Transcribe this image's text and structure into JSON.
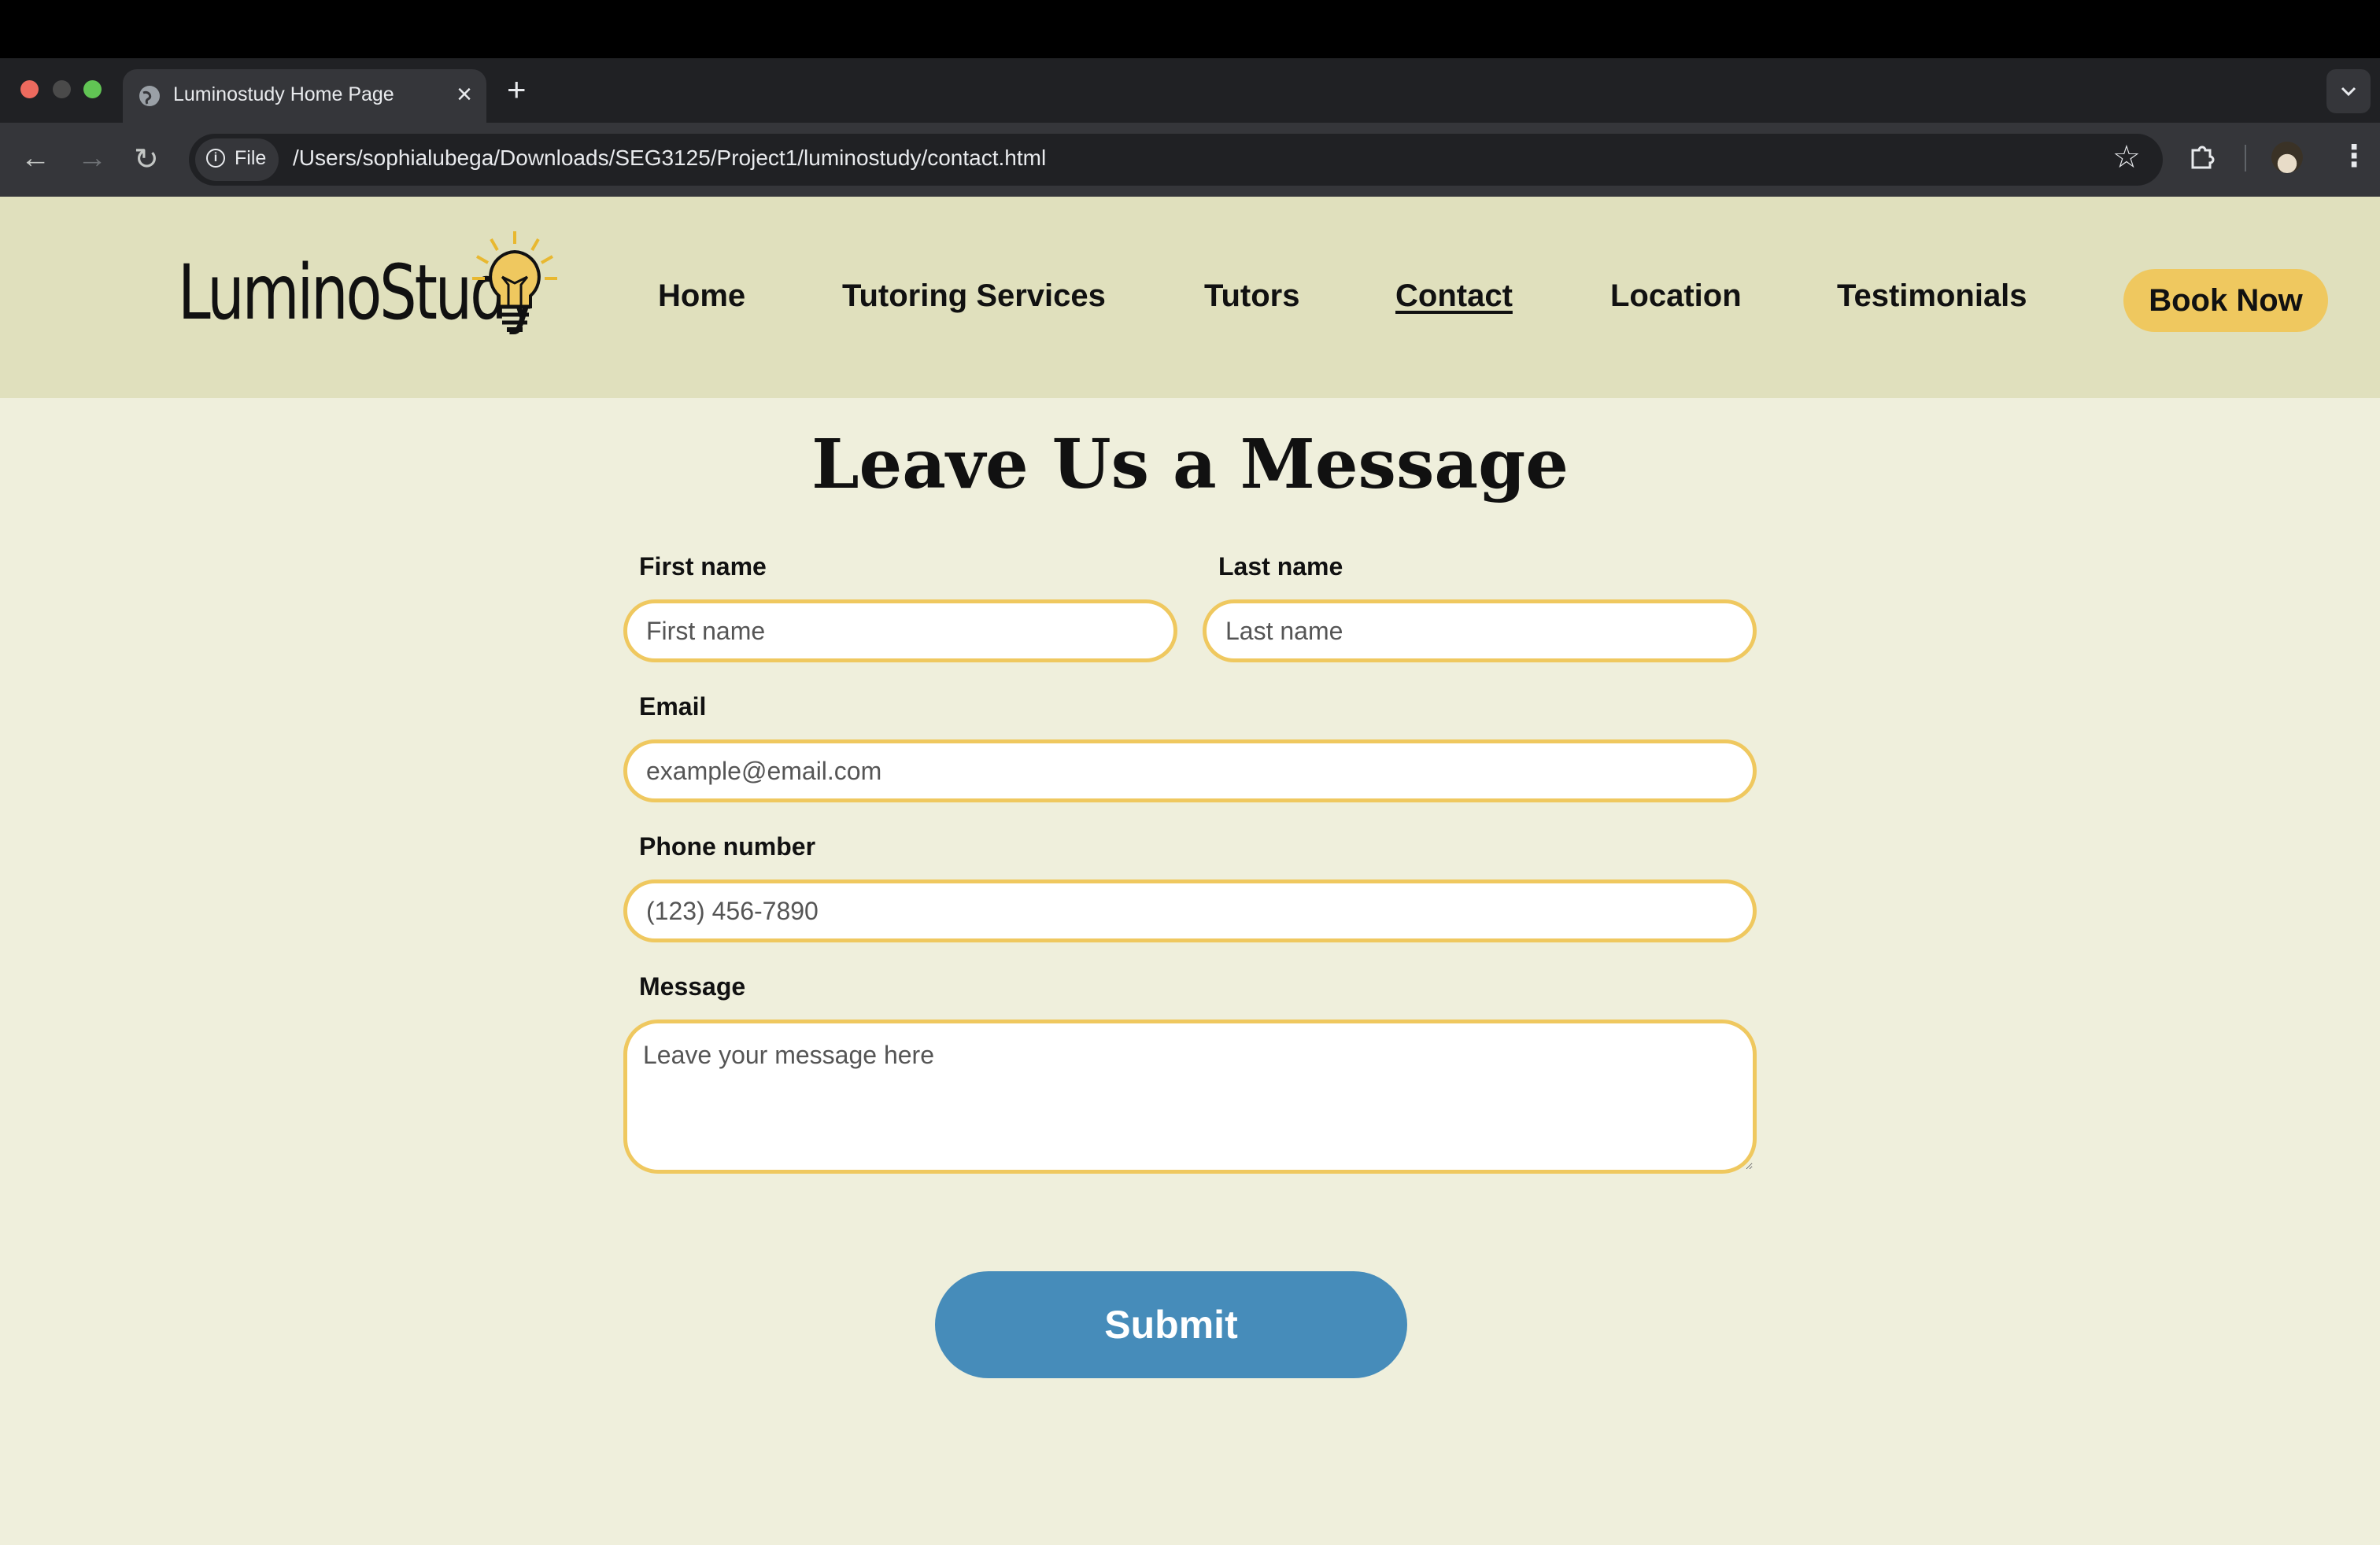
{
  "browser": {
    "tab_title": "Luminostudy Home Page",
    "new_tab": "+",
    "chip_label": "File",
    "url": "/Users/sophialubega/Downloads/SEG3125/Project1/luminostudy/contact.html"
  },
  "site": {
    "logo": "LuminoStudy",
    "nav": [
      {
        "label": "Home"
      },
      {
        "label": "Tutoring Services"
      },
      {
        "label": "Tutors"
      },
      {
        "label": "Contact"
      },
      {
        "label": "Location"
      },
      {
        "label": "Testimonials"
      }
    ],
    "book_now": "Book Now"
  },
  "form": {
    "heading": "Leave Us a Message",
    "first_name": {
      "label": "First name",
      "placeholder": "First name"
    },
    "last_name": {
      "label": "Last name",
      "placeholder": "Last name"
    },
    "email": {
      "label": "Email",
      "placeholder": "example@email.com"
    },
    "phone": {
      "label": "Phone number",
      "placeholder": "(123) 456-7890"
    },
    "message": {
      "label": "Message",
      "placeholder": "Leave your message here"
    },
    "submit": "Submit"
  },
  "colors": {
    "header_bg": "#e0e0bd",
    "page_bg": "#efefdc",
    "accent_yellow": "#efc85f",
    "submit_blue": "#468cba"
  }
}
